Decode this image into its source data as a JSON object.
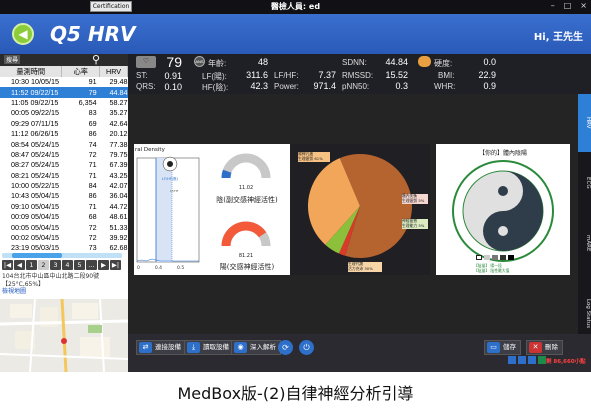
{
  "titlebar": {
    "title": "醫檢人員: ed",
    "certification_label": "Certification",
    "minimize": "–",
    "maximize": "□",
    "close": "×"
  },
  "header": {
    "app_title": "Q5 HRV",
    "greeting": "Hi, 王先生",
    "back_icon": "back-arrow-icon"
  },
  "left_panel": {
    "search_label": "搜尋",
    "columns": [
      "量測時間",
      "心率",
      "HRV"
    ],
    "rows": [
      [
        "10:30 10/05/15",
        "91",
        "29.48"
      ],
      [
        "11:52 09/22/15",
        "79",
        "44.84"
      ],
      [
        "11:05 09/22/15",
        "6,354",
        "58.27"
      ],
      [
        "00:05 09/22/15",
        "83",
        "35.27"
      ],
      [
        "09:29 07/11/15",
        "69",
        "42.64"
      ],
      [
        "11:12 06/26/15",
        "86",
        "20.12"
      ],
      [
        "08:54 05/24/15",
        "74",
        "77.38"
      ],
      [
        "08:47 05/24/15",
        "72",
        "79.75"
      ],
      [
        "08:27 05/24/15",
        "71",
        "67.39"
      ],
      [
        "08:21 05/24/15",
        "71",
        "43.25"
      ],
      [
        "10:00 05/22/15",
        "84",
        "42.07"
      ],
      [
        "10:43 05/04/15",
        "86",
        "36.04"
      ],
      [
        "09:10 05/04/15",
        "71",
        "44.72"
      ],
      [
        "00:09 05/04/15",
        "68",
        "48.61"
      ],
      [
        "00:05 05/04/15",
        "72",
        "51.33"
      ],
      [
        "00:02 05/04/15",
        "72",
        "39.92"
      ],
      [
        "23:19 05/03/15",
        "73",
        "62.68"
      ]
    ],
    "selected_index": 1,
    "pages": [
      "|◀",
      "◀",
      "1",
      "2",
      "3",
      "4",
      "5",
      "…",
      "▶",
      "▶|"
    ],
    "active_page": "2",
    "address": "104台北市中山區中山北路二段90號",
    "weather": "【25°C,65%】",
    "map_link": "檢視地圖"
  },
  "metrics": {
    "heart_rate_value": "79",
    "heart_icon": "heart-rate-icon",
    "ans_icon": "ans-icon",
    "bio_icon": "body-icon",
    "st_label": "ST:",
    "st_value": "0.91",
    "qrs_label": "QRS:",
    "qrs_value": "0.10",
    "age_label": "年齡:",
    "age_value": "48",
    "lf_label": "LF(陽):",
    "lf_value": "311.6",
    "hf_label": "HF(陰):",
    "hf_value": "42.3",
    "lfhf_label": "LF/HF:",
    "lfhf_value": "7.37",
    "power_label": "Power:",
    "power_value": "971.4",
    "sdnn_label": "SDNN:",
    "sdnn_value": "44.84",
    "rmssd_label": "RMSSD:",
    "rmssd_value": "15.52",
    "pnn50_label": "pNN50:",
    "pnn50_value": "0.3",
    "stiff_label": "硬度:",
    "stiff_value": "0.0",
    "bmi_label": "BMI:",
    "bmi_value": "22.9",
    "whr_label": "WHR:",
    "whr_value": "0.9"
  },
  "tabs": [
    "HRV",
    "ECG",
    "mARE",
    "Log Status"
  ],
  "active_tab": "HRV",
  "content": {
    "density_title": "ral Density",
    "density_axis_labels": [
      "0",
      "0.4",
      "0.5"
    ],
    "sympathetic_value": "11.02",
    "sympathetic_label": "陰(副交感神經活性)",
    "parasympathetic_value": "81.21",
    "parasympathetic_label": "陽(交感神經活性)",
    "sympathetic_gauge_fraction": 0.11,
    "parasympathetic_gauge_fraction": 0.81,
    "pie_labels": [
      "陽神亢進\n生理疲勞 61%",
      "體內失衡\n生理疲勞 5%",
      "神經疲憊\n生理能力 5%",
      "生理代謝\n活力充沛 30%"
    ],
    "yinyang_title": "【你的】體內陰陽",
    "yinyang_legend": [
      "【陰量】 陽一段",
      "【陰量】 陰性最大值"
    ]
  },
  "toolbar": {
    "btn1": "連接設備",
    "btn2": "讀取設備",
    "btn3": "深入解析",
    "save": "儲存",
    "delete": "刪除",
    "status_text": "剩 86,660小點"
  },
  "caption": "MedBox版-(2)自律神經分析引導",
  "colors": {
    "header": "#2a5ab8",
    "selected_row": "#2e7fd6",
    "pie_brown": "#b5632f",
    "pie_orange": "#f2a65a",
    "pie_green": "#8cc03a",
    "pie_red": "#d93a2a",
    "gauge_red": "#f25a3a",
    "gauge_blue": "#2d6fc9"
  }
}
